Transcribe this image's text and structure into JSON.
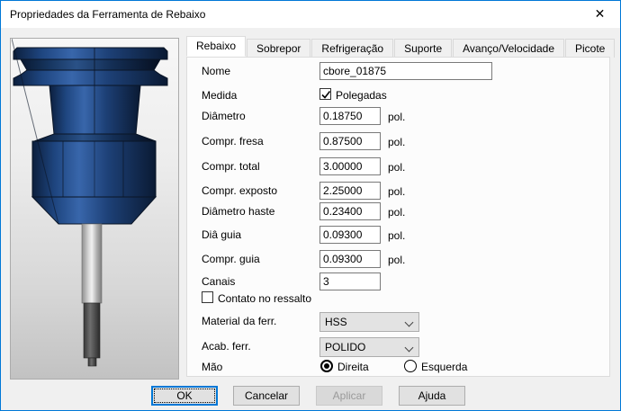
{
  "window": {
    "title": "Propriedades da Ferramenta de Rebaixo",
    "close_glyph": "✕"
  },
  "tabs": [
    {
      "label": "Rebaixo",
      "active": true
    },
    {
      "label": "Sobrepor",
      "active": false
    },
    {
      "label": "Refrigeração",
      "active": false
    },
    {
      "label": "Suporte",
      "active": false
    },
    {
      "label": "Avanço/Velocidade",
      "active": false
    },
    {
      "label": "Picote",
      "active": false
    }
  ],
  "form": {
    "nome": {
      "label": "Nome",
      "value": "cbore_01875"
    },
    "medida": {
      "label": "Medida",
      "checkbox_label": "Polegadas",
      "checked": true
    },
    "fields": [
      {
        "label": "Diâmetro",
        "value": "0.18750",
        "unit": "pol."
      },
      {
        "label": "Compr. fresa",
        "value": "0.87500",
        "unit": "pol."
      },
      {
        "label": "Compr. total",
        "value": "3.00000",
        "unit": "pol."
      },
      {
        "label": "Compr. exposto",
        "value": "2.25000",
        "unit": "pol."
      },
      {
        "label": "Diâmetro haste",
        "value": "0.23400",
        "unit": "pol."
      },
      {
        "label": "Diâ guia",
        "value": "0.09300",
        "unit": "pol."
      },
      {
        "label": "Compr. guia",
        "value": "0.09300",
        "unit": "pol."
      },
      {
        "label": "Canais",
        "value": "3",
        "unit": ""
      }
    ],
    "contato": {
      "label": "Contato no ressalto",
      "checked": false
    },
    "material": {
      "label": "Material da ferr.",
      "value": "HSS"
    },
    "acabamento": {
      "label": "Acab. ferr.",
      "value": "POLIDO"
    },
    "mao": {
      "label": "Mão",
      "options": [
        {
          "label": "Direita",
          "selected": true
        },
        {
          "label": "Esquerda",
          "selected": false
        }
      ]
    }
  },
  "buttons": {
    "ok": "OK",
    "cancel": "Cancelar",
    "apply": "Aplicar",
    "help": "Ajuda"
  },
  "colors": {
    "accent": "#0078D7",
    "dialog_bg": "#F0F0F0",
    "panel_bg": "#FCFCFC",
    "tool_blue": "#1E4077",
    "titlebar": "#FFFFFF"
  }
}
